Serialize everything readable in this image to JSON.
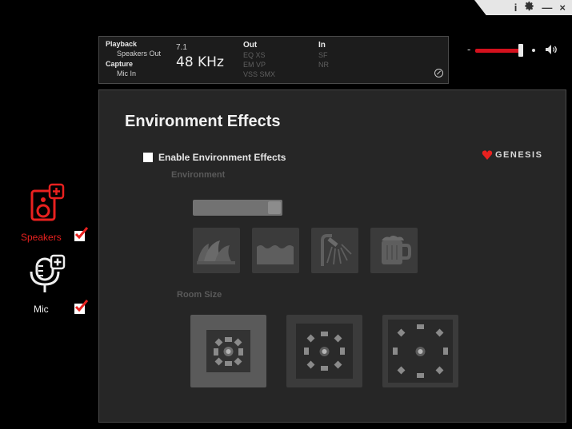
{
  "window_controls": {
    "info": "i",
    "settings_icon": "gear-icon",
    "minimize": "—",
    "close": "×"
  },
  "playback": {
    "title": "Playback",
    "device": "Speakers Out",
    "channels": "7.1",
    "sample_rate": "48  KHz"
  },
  "capture": {
    "title": "Capture",
    "device": "Mic In"
  },
  "out": {
    "title": "Out",
    "r1": "EQ   XS",
    "r2": "EM   VP",
    "r3": "VSS  SMX"
  },
  "in": {
    "title": "In",
    "r1": "SF",
    "r2": "NR"
  },
  "volume": {
    "minus": "-",
    "level": 0.93
  },
  "sidebar": {
    "speakers": {
      "label": "Speakers",
      "checked": true,
      "icon": "speaker-plus-icon"
    },
    "mic": {
      "label": "Mic",
      "checked": true,
      "icon": "microphone-plus-icon"
    }
  },
  "panel": {
    "title": "Environment Effects",
    "enable_label": "Enable Environment Effects",
    "enable_checked": false,
    "brand": "GENESIS",
    "environment_label": "Environment",
    "environment_icons": [
      "opera-house-icon",
      "water-icon",
      "shower-icon",
      "beer-mug-icon"
    ],
    "room_size_label": "Room Size",
    "room_sizes": [
      "small-room-icon",
      "medium-room-icon",
      "large-room-icon"
    ],
    "colors": {
      "accent": "#e8211f",
      "panel": "#262626"
    }
  }
}
